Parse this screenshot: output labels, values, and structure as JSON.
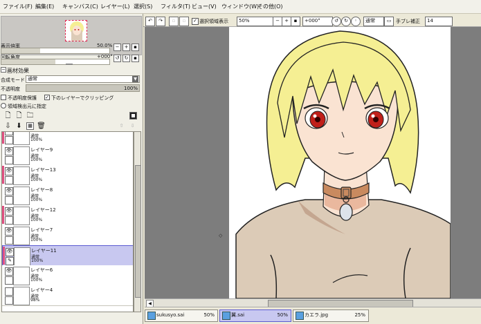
{
  "menu": [
    "ファイル(F)",
    "編集(E)",
    "キャンバス(C)",
    "レイヤー(L)",
    "選択(S)",
    "フィルタ(T)",
    "ビュー(V)",
    "ウィンドウ(W)",
    "その他(O)"
  ],
  "navigator": {
    "zoom_label": "表示倍率",
    "zoom_value": "50.0%",
    "rotate_label": "回転角度",
    "rotate_value": "+000°"
  },
  "texture": {
    "header": "画材効果",
    "blend_label": "合成モード",
    "blend_value": "通常",
    "opacity_label": "不透明度",
    "opacity_value": "100%",
    "preserve_opacity": "不透明度保護",
    "clip_lower": "下のレイヤーでクリッピング",
    "selection_source": "領域検出元に指定"
  },
  "layers": [
    {
      "name": "レイヤー14",
      "mode": "通常",
      "opacity": "100%",
      "mark": "#e05080",
      "visible": false
    },
    {
      "name": "レイヤー9",
      "mode": "通常",
      "opacity": "100%",
      "mark": "",
      "visible": true
    },
    {
      "name": "レイヤー13",
      "mode": "通常",
      "opacity": "100%",
      "mark": "#e05080",
      "visible": true
    },
    {
      "name": "レイヤー8",
      "mode": "通常",
      "opacity": "100%",
      "mark": "",
      "visible": true
    },
    {
      "name": "レイヤー12",
      "mode": "通常",
      "opacity": "100%",
      "mark": "#e05080",
      "visible": true
    },
    {
      "name": "レイヤー7",
      "mode": "通常",
      "opacity": "100%",
      "mark": "",
      "visible": true
    },
    {
      "name": "レイヤー11",
      "mode": "通常",
      "opacity": "100%",
      "mark": "#e05080",
      "visible": true,
      "selected": true
    },
    {
      "name": "レイヤー6",
      "mode": "通常",
      "opacity": "100%",
      "mark": "",
      "visible": true
    },
    {
      "name": "レイヤー4",
      "mode": "通常",
      "opacity": "98%",
      "mark": "",
      "visible": false
    }
  ],
  "toolbar": {
    "show_selection": "選択領域表示",
    "zoom": "50%",
    "rotation": "+000°",
    "mode": "通常",
    "stabilizer_label": "手ブレ補正",
    "stabilizer_value": "14"
  },
  "tabs": [
    {
      "name": "sukusyo.sai",
      "zoom": "50%",
      "active": false
    },
    {
      "name": "翼.sai",
      "zoom": "50%",
      "active": true
    },
    {
      "name": "カエラ.jpg",
      "zoom": "25%",
      "active": false
    }
  ],
  "colors": {
    "selected_layer": "#c8c8f0",
    "hair": "#f5ef93",
    "skin": "#fae3d2",
    "shirt": "#dccbb7",
    "collar": "#c98a5f",
    "eyes": "#c0201a"
  }
}
